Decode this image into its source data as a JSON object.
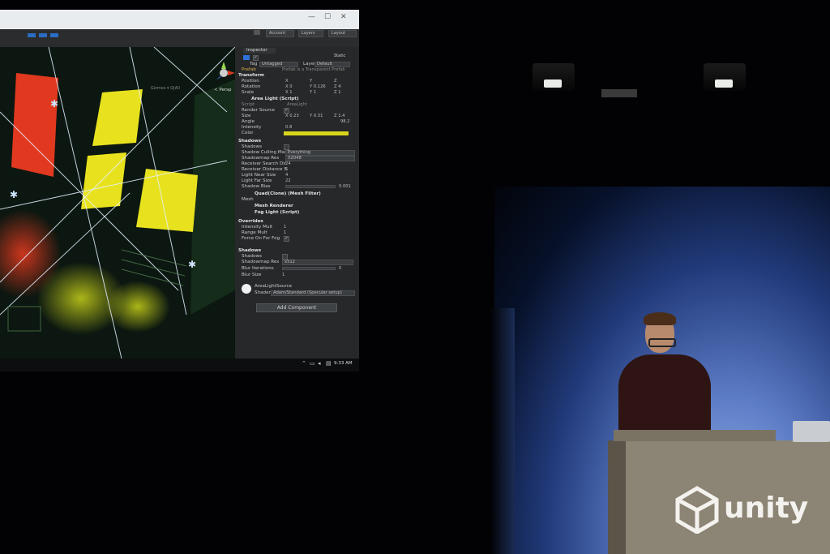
{
  "unity_window": {
    "toolbar": {
      "account": "Account",
      "layers": "Layers",
      "layout": "Layout"
    },
    "scene": {
      "persp_label": "< Persp",
      "toolbar_hint": "Gizmos ▾  Q|All"
    },
    "inspector": {
      "tab": "Inspector",
      "static_label": "Static",
      "tag_label": "Tag",
      "tag_value": "Untagged",
      "layer_label": "Layer",
      "layer_value": "Default",
      "prefab_row": "Prefab",
      "prefab_note": "Prefab is a Transparent Prefab",
      "transform": {
        "header": "Transform",
        "position_label": "Position",
        "position": [
          "X",
          "Y",
          "Z"
        ],
        "rotation_label": "Rotation",
        "rotation": [
          "X 0",
          "Y 0.126",
          "Z 4"
        ],
        "scale_label": "Scale",
        "scale": [
          "X 1",
          "Y 1",
          "Z 1"
        ]
      },
      "area_light": {
        "header": "Area Light (Script)",
        "script_label": "Script",
        "script_value": "AreaLight",
        "render_source_label": "Render Source",
        "size_label": "Size",
        "size": [
          "X 0.23",
          "Y 0.31",
          "Z 1.4"
        ],
        "angle_label": "Angle",
        "angle_value": "98.2",
        "intensity_label": "Intensity",
        "intensity_value": "0.8",
        "color_label": "Color",
        "color": "#d8d41c",
        "shadows_header": "Shadows",
        "shadows_label": "Shadows",
        "culling_label": "Shadow Culling Mask",
        "culling_value": "Everything",
        "shadowmap_label": "Shadowmap Res",
        "shadowmap_value": "X2048",
        "receiver_search_label": "Receiver Search Dir",
        "receiver_search_value": "24",
        "receiver_distance_label": "Receiver Distance S",
        "receiver_distance_value": "5",
        "near_size_label": "Light Near Size",
        "near_size_value": "4",
        "far_size_label": "Light Far Size",
        "far_size_value": "22",
        "shadow_bias_label": "Shadow Bias",
        "shadow_bias_value": "0.001"
      },
      "mesh_filter": {
        "header": "Quad(Clone) (Mesh Filter)",
        "mesh_label": "Mesh"
      },
      "mesh_renderer": {
        "header": "Mesh Renderer"
      },
      "fog_light": {
        "header": "Fog Light (Script)",
        "overrides_header": "Overrides",
        "intensity_mult_label": "Intensity Mult",
        "intensity_mult_value": "1",
        "range_mult_label": "Range Mult",
        "range_mult_value": "1",
        "force_on_label": "Force On For Fog",
        "shadows_header": "Shadows",
        "shadows_label": "Shadows",
        "shadowmap_label": "Shadowmap Res",
        "shadowmap_value": "x512",
        "blur_iter_label": "Blur Iterations",
        "blur_iter_value": "0",
        "blur_size_label": "Blur Size",
        "blur_size_value": "1"
      },
      "material": {
        "name": "AreaLightSource",
        "shader_label": "Shader",
        "shader_value": "Adam/Standard (Specular setup)"
      },
      "add_component": "Add Component"
    },
    "taskbar": {
      "clock": "9:33 AM"
    }
  },
  "brand": {
    "logo_text": "unity"
  },
  "colors": {
    "screen_yellow": "#e8e21e",
    "screen_red": "#e0391f",
    "backdrop": "#5c7cc6"
  }
}
